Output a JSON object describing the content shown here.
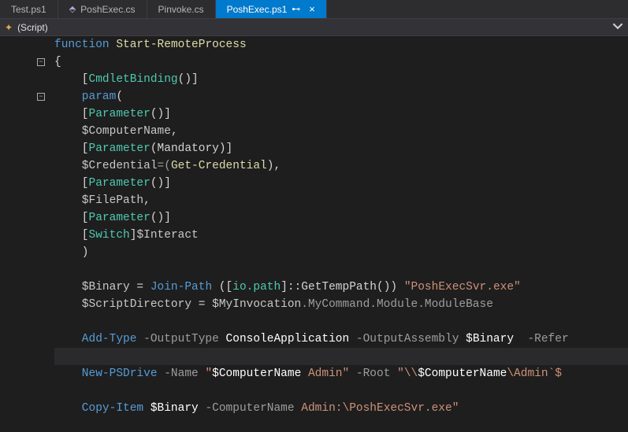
{
  "tabs": [
    {
      "label": "Test.ps1",
      "active": false
    },
    {
      "label": "PoshExec.cs",
      "active": false
    },
    {
      "label": "Pinvoke.cs",
      "active": false
    },
    {
      "label": "PoshExec.ps1",
      "active": true
    }
  ],
  "scriptBar": {
    "label": "(Script)"
  },
  "code": {
    "l0": {
      "kw": "function",
      "fn": " Start-RemoteProcess"
    },
    "l1": "{",
    "l2": {
      "open": "    [",
      "type": "CmdletBinding",
      "close": "()]"
    },
    "l3": {
      "kw": "    param",
      "open": "("
    },
    "l4": {
      "open": "    [",
      "type": "Parameter",
      "close": "()]"
    },
    "l5": {
      "var": "    $ComputerName",
      "punc": ","
    },
    "l6": {
      "open": "    [",
      "type": "Parameter",
      "mid": "(Mandatory)]"
    },
    "l7": {
      "var": "    $Credential",
      "eq": "=(",
      "ident": "Get-Credential",
      "close": "),"
    },
    "l8": {
      "open": "    [",
      "type": "Parameter",
      "close": "()]"
    },
    "l9": {
      "var": "    $FilePath",
      "punc": ","
    },
    "l10": {
      "open": "    [",
      "type": "Parameter",
      "close": "()]"
    },
    "l11": {
      "open": "    [",
      "type": "Switch",
      "close": "]",
      "var": "$Interact"
    },
    "l12": "    )",
    "l14": {
      "var": "    $Binary",
      "eq": " = ",
      "fn": "Join-Path",
      "mid1": " ([",
      "type": "io.path",
      "mid2": "]::GetTempPath()) ",
      "str": "\"PoshExecSvr.exe\""
    },
    "l15": {
      "var": "    $ScriptDirectory",
      "eq": " = ",
      "var2": "$MyInvocation",
      "tail": ".MyCommand.Module.ModuleBase"
    },
    "l17": {
      "fn": "    Add-Type",
      "g1": " -OutputType ",
      "v1": "ConsoleApplication",
      "g2": " -OutputAssembly ",
      "v2": "$Binary",
      "g3": "  -Refer"
    },
    "l19": {
      "fn": "    New-PSDrive",
      "g1": " -Name ",
      "s1a": "\"",
      "s1v": "$ComputerName",
      "s1b": " Admin\"",
      "g2": " -Root ",
      "s2a": "\"\\\\",
      "s2v": "$ComputerName",
      "s2b": "\\Admin`$"
    },
    "l21": {
      "fn": "    Copy-Item",
      "sp": " ",
      "v1": "$Binary",
      "g1": " -ComputerName ",
      "s1a": "Admin:\\PoshExecSvr.exe",
      "q": "\""
    }
  }
}
